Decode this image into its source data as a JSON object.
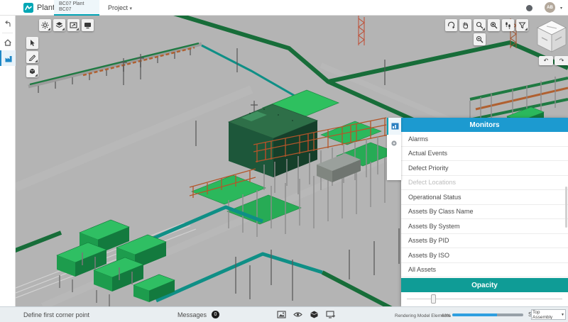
{
  "header": {
    "app_name": "PlantSight",
    "tab_line1": "BC07 Plant",
    "tab_line2": "BC07",
    "project_label": "Project",
    "project_caret": "▾",
    "avatar_initials": "AB",
    "avatar_caret": "▾"
  },
  "panel": {
    "title": "Monitors",
    "items": [
      "Alarms",
      "Actual Events",
      "Defect Priority",
      "Defect Locations",
      "Operational Status",
      "Assets By Class Name",
      "Assets By System",
      "Assets By PID",
      "Assets By ISO",
      "All Assets"
    ],
    "disabled_item": "Defect Locations",
    "opacity_label": "Opacity"
  },
  "statusbar": {
    "prompt": "Define first corner point",
    "messages_label": "Messages",
    "messages_count": "0",
    "rendering_label": "Rendering Model Elements",
    "rendering_percent": "63%",
    "scope_label": "Scope:",
    "scope_value": "Top Assembly",
    "scope_caret": "▼"
  },
  "view_arrows": {
    "undo": "↶",
    "redo": "↷"
  },
  "colors": {
    "brand_teal": "#00a3b4",
    "monitors_header_blue": "#1c9ad0",
    "opacity_header_teal": "#0f9c96",
    "progress_fill_blue": "#2f9fe0",
    "sidebar_active_blue": "#1e88c7",
    "viewport_background": "#b4b4b4"
  }
}
